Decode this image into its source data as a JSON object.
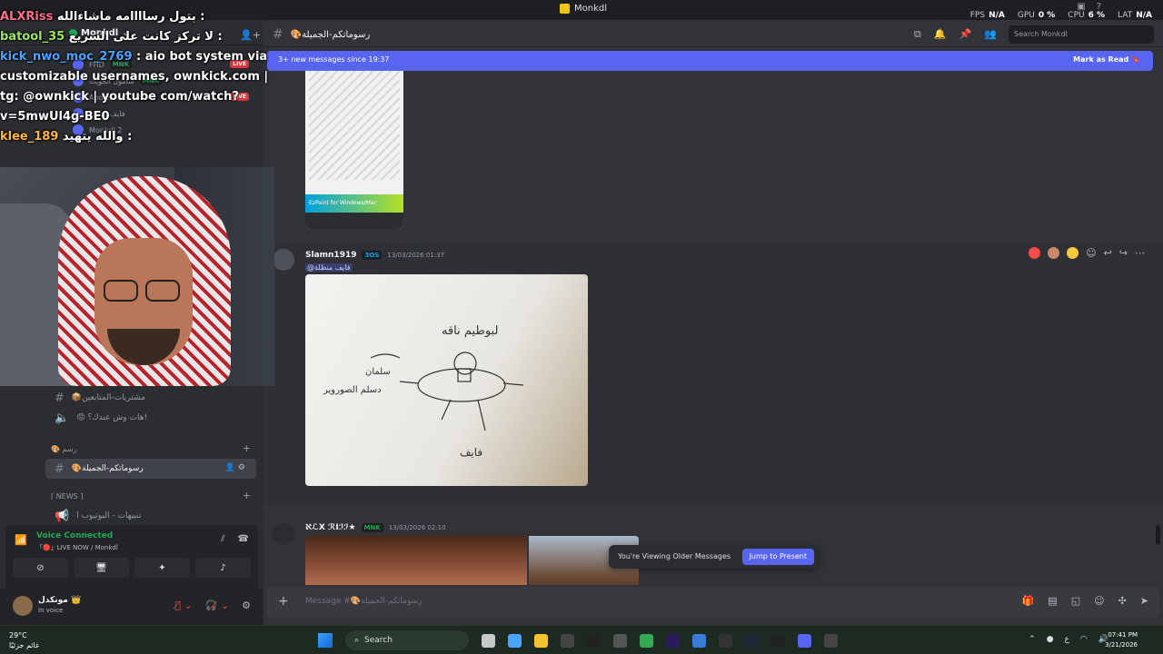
{
  "window": {
    "title": "Monkdl",
    "perf": {
      "fps_label": "FPS",
      "fps": "N/A",
      "gpu_label": "GPU",
      "gpu": "0 %",
      "cpu_label": "CPU",
      "cpu": "6 %",
      "lat_label": "LAT",
      "lat": "N/A"
    }
  },
  "stream_chat": [
    {
      "user": "ALXRiss",
      "text": "بتول رساااامه ماشاءالله :"
    },
    {
      "user": "batool_35",
      "text": "لا تركز كانت على السريع :"
    },
    {
      "user": "kick_nwo_moc_2769",
      "text": ": aio bot system via customizable usernames, ownkick.com | tg: @ownkick | youtube com/watch?v=5mwUl4g-BE0"
    },
    {
      "user": "klee_189",
      "text": "والله يتهيد :"
    }
  ],
  "sidebar": {
    "server_name": "Monkdl",
    "dm_items": [
      {
        "name": "FHD",
        "tag": "MNK",
        "live": "LIVE"
      },
      {
        "name": "سامول انجويت",
        "tag": "MNK"
      },
      {
        "name": "Abdulah Kh",
        "tag": "MNK",
        "live": "LIVE"
      },
      {
        "name": "فايف منظله"
      },
      {
        "name": "Monkdl 2"
      }
    ],
    "channels": [
      {
        "type": "channel",
        "label": "📦مشتريات-المتابعين"
      },
      {
        "type": "voice",
        "label": "😡 هات وش عندك؟!"
      },
      {
        "type": "category",
        "label": "🎨 رسم"
      },
      {
        "type": "channel",
        "label": "🎨رسوماتكم-الجميلة",
        "active": true
      },
      {
        "type": "category",
        "label": "⌈ NEWS ⌉"
      },
      {
        "type": "channel",
        "label": "تنبيهات - اليوتيوب ا"
      }
    ],
    "voice": {
      "status": "Voice Connected",
      "sub": "「🔴」LIVE NOW / Monkdl",
      "buttons": [
        "camera-off",
        "screen-share",
        "activities",
        "soundboard"
      ]
    },
    "user": {
      "name": "مونكدل 👑",
      "status": "In voice"
    }
  },
  "header": {
    "channel": "🎨رسوماتكم-الجميلة",
    "search_placeholder": "Search Monkdl"
  },
  "banner": {
    "text": "3+ new messages since 19:37",
    "action": "Mark as Read"
  },
  "image1": {
    "brand": "EzPaint for Windows/Mac"
  },
  "messages": [
    {
      "author": "Slamn1919",
      "tag": "3OS",
      "time": "13/03/2026 01:37",
      "mention": "@فايف منظلة"
    },
    {
      "author": "ℵℒX ℛIℐℐ★",
      "tag": "MNK",
      "time": "13/03/2026 02:10"
    }
  ],
  "drawing_text": {
    "top": "لبوطيم ناقه",
    "left": "سلمان",
    "left2": "دسلم الصوروير",
    "bottom": "فايف"
  },
  "toast": {
    "text": "You're Viewing Older Messages",
    "button": "Jump to Present"
  },
  "composer": {
    "placeholder": "Message #🎨رسوماتكم-الجميلة"
  },
  "taskbar": {
    "weather_temp": "29°C",
    "weather_text": "غائم جزئيًا",
    "search": "Search",
    "time": "07:41 PM",
    "date": "3/21/2026",
    "lang": "ع"
  }
}
